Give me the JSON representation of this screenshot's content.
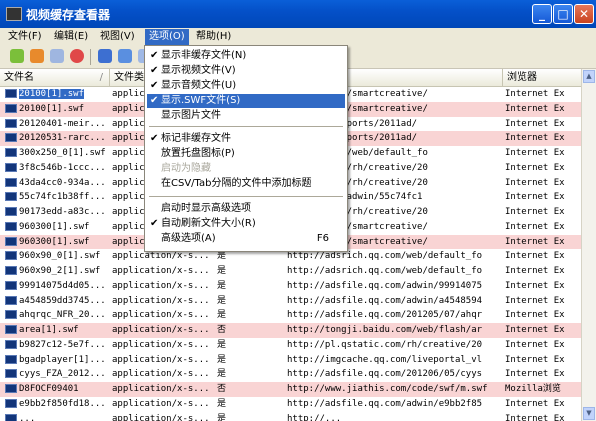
{
  "window": {
    "title": "视频缓存查看器"
  },
  "menubar": [
    {
      "label": "文件(F)"
    },
    {
      "label": "编辑(E)"
    },
    {
      "label": "视图(V)"
    },
    {
      "label": "选项(O)"
    },
    {
      "label": "帮助(H)"
    }
  ],
  "columns": [
    {
      "label": "文件名"
    },
    {
      "label": "文件类"
    },
    {
      "label": ""
    },
    {
      "label": ""
    },
    {
      "label": "浏览器"
    }
  ],
  "rows": [
    {
      "name": "20100[1].swf",
      "type": "applicat",
      "cache": "",
      "url": "rich.qq.com/smartcreative/",
      "browser": "Internet Ex",
      "style": "sel"
    },
    {
      "name": "20100[1].swf",
      "type": "applicat",
      "cache": "",
      "url": "rich.qq.com/smartcreative/",
      "browser": "Internet Ex",
      "style": "pink"
    },
    {
      "name": "20120401-meir...",
      "type": "applicat",
      "cache": "",
      "url": "gtimg.com/sports/2011ad/",
      "browser": "Internet Ex",
      "style": "plain"
    },
    {
      "name": "20120531-rarc...",
      "type": "applicat",
      "cache": "",
      "url": "gtimg.com/sports/2011ad/",
      "browser": "Internet Ex",
      "style": "pink"
    },
    {
      "name": "300x250_0[1].swf",
      "type": "applicat",
      "cache": "",
      "url": "rich.qq.com/web/default_fo",
      "browser": "Internet Ex",
      "style": "plain"
    },
    {
      "name": "3f8c546b-1ccc...",
      "type": "applicat",
      "cache": "",
      "url": "qstatic.com/rh/creative/20",
      "browser": "Internet Ex",
      "style": "plain"
    },
    {
      "name": "43da4cc0-934a...",
      "type": "applicat",
      "cache": "",
      "url": "qstatic.com/rh/creative/20",
      "browser": "Internet Ex",
      "style": "plain"
    },
    {
      "name": "55c74fc1b38ff...",
      "type": "applicat",
      "cache": "",
      "url": "ile.qq.com/adwin/55c74fc1",
      "browser": "Internet Ex",
      "style": "plain"
    },
    {
      "name": "90173edd-a83c...",
      "type": "applicat",
      "cache": "",
      "url": "qstatic.com/rh/creative/20",
      "browser": "Internet Ex",
      "style": "plain"
    },
    {
      "name": "960300[1].swf",
      "type": "applicat",
      "cache": "",
      "url": "rich.qq.com/smartcreative/",
      "browser": "Internet Ex",
      "style": "plain"
    },
    {
      "name": "960300[1].swf",
      "type": "applicat",
      "cache": "",
      "url": "rich.qq.com/smartcreative/",
      "browser": "Internet Ex",
      "style": "pink"
    },
    {
      "name": "960x90_0[1].swf",
      "type": "application/x-s...",
      "cache": "是",
      "url": "http://adsrich.qq.com/web/default_fo",
      "browser": "Internet Ex",
      "style": "plain"
    },
    {
      "name": "960x90_2[1].swf",
      "type": "application/x-s...",
      "cache": "是",
      "url": "http://adsrich.qq.com/web/default_fo",
      "browser": "Internet Ex",
      "style": "plain"
    },
    {
      "name": "99914075d4d05...",
      "type": "application/x-s...",
      "cache": "是",
      "url": "http://adsfile.qq.com/adwin/99914075",
      "browser": "Internet Ex",
      "style": "plain"
    },
    {
      "name": "a454859dd3745...",
      "type": "application/x-s...",
      "cache": "是",
      "url": "http://adsfile.qq.com/adwin/a4548594",
      "browser": "Internet Ex",
      "style": "plain"
    },
    {
      "name": "ahqrqc_NFR_20...",
      "type": "application/x-s...",
      "cache": "是",
      "url": "http://adsfile.qq.com/201205/07/ahqr",
      "browser": "Internet Ex",
      "style": "plain"
    },
    {
      "name": "area[1].swf",
      "type": "application/x-s...",
      "cache": "否",
      "url": "http://tongji.baidu.com/web/flash/ar",
      "browser": "Internet Ex",
      "style": "pink"
    },
    {
      "name": "b9827c12-5e7f...",
      "type": "application/x-s...",
      "cache": "是",
      "url": "http://pl.qstatic.com/rh/creative/20",
      "browser": "Internet Ex",
      "style": "plain"
    },
    {
      "name": "bgadplayer[1]...",
      "type": "application/x-s...",
      "cache": "是",
      "url": "http://imgcache.qq.com/liveportal_vl",
      "browser": "Internet Ex",
      "style": "plain"
    },
    {
      "name": "cyys_FZA_2012...",
      "type": "application/x-s...",
      "cache": "是",
      "url": "http://adsfile.qq.com/201206/05/cyys",
      "browser": "Internet Ex",
      "style": "plain"
    },
    {
      "name": "D8FOCF09401",
      "type": "application/x-s...",
      "cache": "否",
      "url": "http://www.jiathis.com/code/swf/m.swf",
      "browser": "Mozilla浏览",
      "style": "pink"
    },
    {
      "name": "e9bb2f850fd18...",
      "type": "application/x-s...",
      "cache": "是",
      "url": "http://adsfile.qq.com/adwin/e9bb2f85",
      "browser": "Internet Ex",
      "style": "plain"
    },
    {
      "name": "...",
      "type": "application/x-s...",
      "cache": "是",
      "url": "http://...",
      "browser": "Internet Ex",
      "style": "plain"
    }
  ],
  "options_menu": {
    "items": [
      {
        "label": "显示非缓存文件",
        "key": "(N)",
        "checked": "✔",
        "state": "normal"
      },
      {
        "label": "显示视频文件",
        "key": "(V)",
        "checked": "✔",
        "state": "normal"
      },
      {
        "label": "显示音频文件",
        "key": "(U)",
        "checked": "✔",
        "state": "normal"
      },
      {
        "label": "显示.SWF文件",
        "key": "(S)",
        "checked": "✔",
        "state": "highlight"
      },
      {
        "label": "显示图片文件",
        "key": "",
        "checked": "",
        "state": "normal"
      },
      {
        "label": "标记非缓存文件",
        "key": "",
        "checked": "✔",
        "state": "normal"
      },
      {
        "label": "放置托盘图标",
        "key": "(P)",
        "checked": "",
        "state": "normal"
      },
      {
        "label": "启动为隐藏",
        "key": "",
        "checked": "",
        "state": "disabled"
      },
      {
        "label": "在CSV/Tab分隔的文件中添加标题",
        "key": "",
        "checked": "",
        "state": "normal"
      },
      {
        "label": "启动时显示高级选项",
        "key": "",
        "checked": "",
        "state": "normal"
      },
      {
        "label": "自动刷新文件大小",
        "key": "(R)",
        "checked": "✔",
        "state": "normal"
      },
      {
        "label": "高级选项",
        "key": "(A)",
        "checked": "",
        "state": "normal",
        "shortcut": "F6"
      }
    ]
  }
}
